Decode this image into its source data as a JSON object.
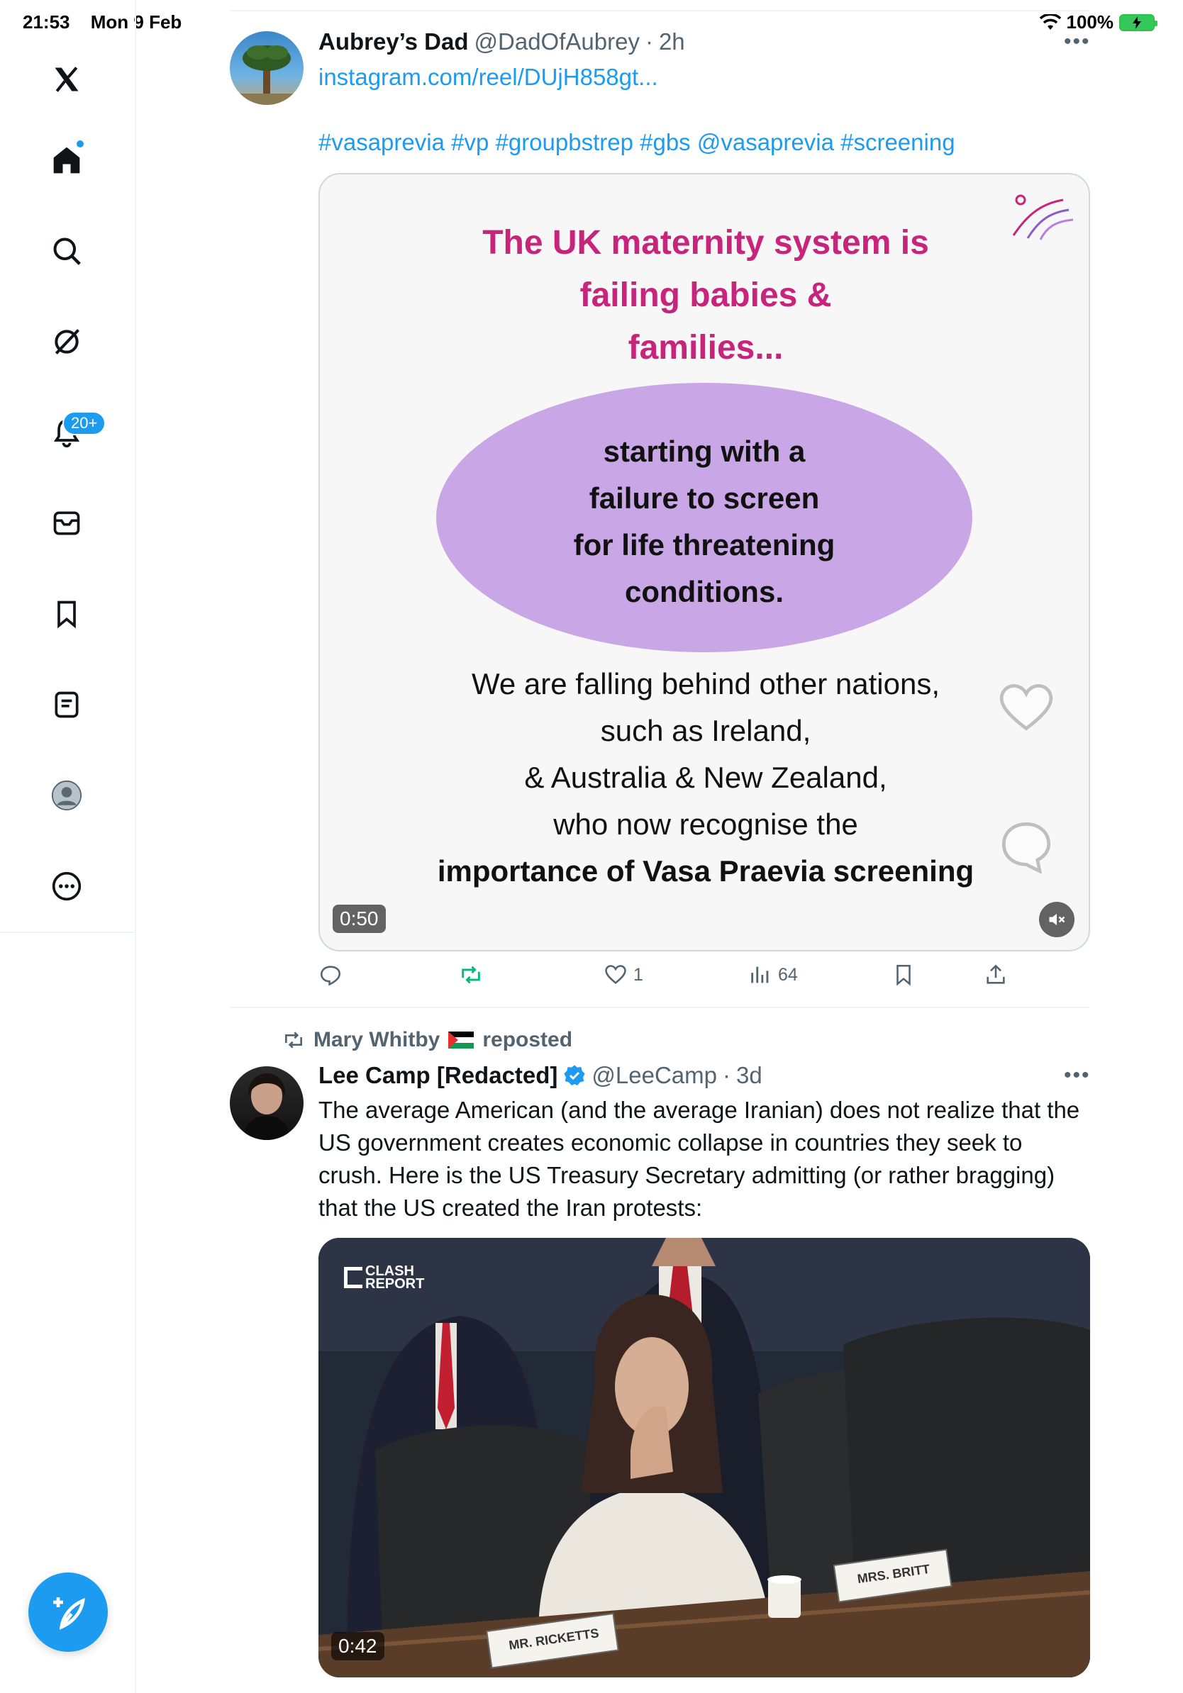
{
  "status_bar": {
    "time": "21:53",
    "date": "Mon 9 Feb",
    "battery": "100%"
  },
  "sidebar": {
    "items": [
      {
        "name": "x-logo"
      },
      {
        "name": "home"
      },
      {
        "name": "search"
      },
      {
        "name": "grok"
      },
      {
        "name": "notifications",
        "badge": "20+"
      },
      {
        "name": "messages"
      },
      {
        "name": "bookmarks"
      },
      {
        "name": "lists"
      },
      {
        "name": "profile"
      },
      {
        "name": "more"
      }
    ],
    "compose_label": "Compose"
  },
  "tweet1": {
    "name": "Aubrey’s Dad",
    "handle": "@DadOfAubrey",
    "dot": "·",
    "time": "2h",
    "link": "instagram.com/reel/DUjH858gt...",
    "hashtags": "#vasaprevia #vp #groupbstrep #gbs @vasaprevia #screening",
    "media": {
      "title_lines": [
        "The UK maternity system is",
        "failing babies &",
        "families..."
      ],
      "ellipse_lines": [
        "starting with a",
        "failure to screen",
        "for life threatening",
        "conditions."
      ],
      "lower_lines": [
        "We are falling behind other nations,",
        "such as Ireland,",
        "& Australia & New Zealand,",
        "who now recognise the"
      ],
      "lower_bold": "importance of Vasa Praevia screening",
      "duration": "0:50"
    },
    "actions": {
      "replies": "",
      "reposts": "",
      "likes": "1",
      "views": "64"
    }
  },
  "tweet2": {
    "reposted_by": "Mary Whitby",
    "reposted_label": "reposted",
    "name": "Lee Camp [Redacted]",
    "handle": "@LeeCamp",
    "dot": "·",
    "time": "3d",
    "text": "The average American (and the average Iranian) does not realize that the US government creates economic collapse in countries they seek to crush. Here is the US Treasury Secretary admitting (or rather bragging) that the US created the Iran protests:",
    "media": {
      "logo_top": "CLASH",
      "logo_bottom": "REPORT",
      "placard_left": "MR. RICKETTS",
      "placard_right": "MRS. BRITT",
      "duration": "0:42"
    }
  },
  "colors": {
    "accent": "#1d9bf0",
    "title_pink": "#c7247b",
    "ellipse_lilac": "#c9a6e6",
    "repost_green": "#00ba7c"
  }
}
